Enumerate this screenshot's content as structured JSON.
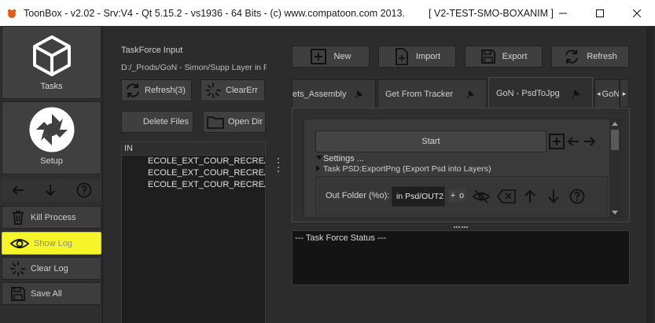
{
  "window": {
    "title": "ToonBox - v2.02 - Srv:V4 - Qt 5.15.2 - vs1936 - 64 Bits - (c) www.compatoon.com 2013.",
    "subtitle": "[ V2-TEST-SMO-BOXANIM ]",
    "controls": [
      "minimize",
      "maximize",
      "close"
    ]
  },
  "sidebar": {
    "tasks_label": "Tasks",
    "setup_label": "Setup",
    "nav_icons": [
      "arrow-left-icon",
      "arrow-down-icon",
      "help-icon"
    ],
    "kill_process": "Kill Process",
    "show_log": "Show Log",
    "clear_log": "Clear Log",
    "save_all": "Save All"
  },
  "taskforce": {
    "input_label": "TaskForce Input",
    "path": "D:/_Prods/GoN - Simon/Supp Layer in PSD",
    "refresh_label": "Refresh(3)",
    "clear_err_label": "ClearErr",
    "delete_files_label": "Delete Files",
    "open_dir_label": "Open Dir",
    "list_header": "IN",
    "files": [
      "ECOLE_EXT_COUR_RECREATION",
      "ECOLE_EXT_COUR_RECREATION",
      "ECOLE_EXT_COUR_RECREATION"
    ]
  },
  "toolbar": {
    "new_label": "New",
    "import_label": "Import",
    "export_label": "Export",
    "refresh_label": "Refresh"
  },
  "tabs": [
    {
      "label": "ets_Assembly",
      "active": false
    },
    {
      "label": "Get From Tracker",
      "active": false
    },
    {
      "label": "GoN - PsdToJpg",
      "active": true
    },
    {
      "label": "GoN",
      "active": false
    }
  ],
  "task": {
    "start_label": "Start",
    "settings_label": "Settings ...",
    "task_label": "Task PSD:ExportPng (Export Psd into Layers)",
    "out_folder_label": "Out Folder (%o):",
    "out_folder_value": "in Psd/OUT2",
    "plus_label": "+",
    "o_label": "o"
  },
  "status": {
    "text": "--- Task Force Status ---"
  },
  "colors": {
    "show_log_highlight": "#f5f52a",
    "background": "#2b2b2b"
  }
}
